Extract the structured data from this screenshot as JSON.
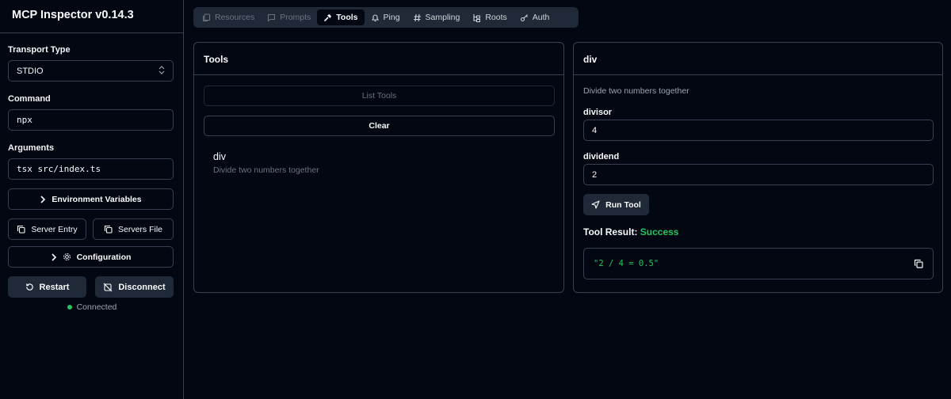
{
  "app": {
    "title": "MCP Inspector v0.14.3"
  },
  "sidebar": {
    "transport_label": "Transport Type",
    "transport_value": "STDIO",
    "command_label": "Command",
    "command_value": "npx",
    "arguments_label": "Arguments",
    "arguments_value": "tsx src/index.ts",
    "env_button": "Environment Variables",
    "server_entry_button": "Server Entry",
    "servers_file_button": "Servers File",
    "config_button": "Configuration",
    "restart_button": "Restart",
    "disconnect_button": "Disconnect",
    "status": "Connected",
    "status_color": "#22c55e"
  },
  "tabs": [
    {
      "label": "Resources",
      "icon": "files-icon",
      "state": "disabled"
    },
    {
      "label": "Prompts",
      "icon": "message-icon",
      "state": "disabled"
    },
    {
      "label": "Tools",
      "icon": "hammer-icon",
      "state": "active"
    },
    {
      "label": "Ping",
      "icon": "bell-icon",
      "state": "normal"
    },
    {
      "label": "Sampling",
      "icon": "hash-icon",
      "state": "normal"
    },
    {
      "label": "Roots",
      "icon": "folder-tree-icon",
      "state": "normal"
    },
    {
      "label": "Auth",
      "icon": "key-icon",
      "state": "normal"
    }
  ],
  "tools_panel": {
    "title": "Tools",
    "list_button": "List Tools",
    "clear_button": "Clear",
    "items": [
      {
        "name": "div",
        "description": "Divide two numbers together"
      }
    ]
  },
  "detail_panel": {
    "title": "div",
    "description": "Divide two numbers together",
    "params": [
      {
        "label": "divisor",
        "value": "4"
      },
      {
        "label": "dividend",
        "value": "2"
      }
    ],
    "run_button": "Run Tool",
    "result_label": "Tool Result:",
    "result_status": "Success",
    "result_text": "\"2 / 4 = 0.5\"",
    "accent_color": "#22c55e"
  }
}
